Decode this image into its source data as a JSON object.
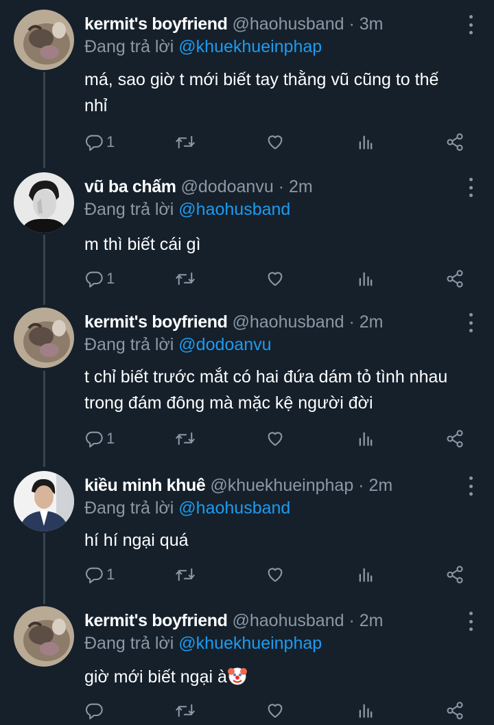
{
  "tweets": [
    {
      "name": "kermit's boyfriend",
      "handle": "@haohusband",
      "separator": "·",
      "time": "3m",
      "reply_prefix": "Đang trả lời",
      "reply_to": "@khuekhueinphap",
      "text_lines": [
        "má, sao giờ t mới biết tay thằng vũ cũng to thế",
        "nhỉ"
      ],
      "reply_count": "1",
      "avatar": "cat-avatar"
    },
    {
      "name": "vũ ba chấm",
      "handle": "@dodoanvu",
      "separator": "·",
      "time": "2m",
      "reply_prefix": "Đang trả lời",
      "reply_to": "@haohusband",
      "text_lines": [
        "m thì biết cái gì"
      ],
      "reply_count": "1",
      "avatar": "person-bw-avatar"
    },
    {
      "name": "kermit's boyfriend",
      "handle": "@haohusband",
      "separator": "·",
      "time": "2m",
      "reply_prefix": "Đang trả lời",
      "reply_to": "@dodoanvu",
      "text_lines": [
        "t chỉ biết trước mắt có hai đứa dám tỏ tình nhau",
        "trong đám đông mà mặc kệ người đời"
      ],
      "reply_count": "1",
      "avatar": "cat-avatar"
    },
    {
      "name": "kiều minh khuê",
      "handle": "@khuekhueinphap",
      "separator": "·",
      "time": "2m",
      "reply_prefix": "Đang trả lời",
      "reply_to": "@haohusband",
      "text_lines": [
        "hí hí ngại quá"
      ],
      "reply_count": "1",
      "avatar": "person-suit-avatar"
    },
    {
      "name": "kermit's boyfriend",
      "handle": "@haohusband",
      "separator": "·",
      "time": "2m",
      "reply_prefix": "Đang trả lời",
      "reply_to": "@khuekhueinphap",
      "text_lines": [
        "giờ mới biết ngại à"
      ],
      "trailing_emoji": "clown-face-emoji",
      "reply_count": "",
      "avatar": "cat-avatar"
    }
  ],
  "icons": {
    "reply": "reply-icon",
    "retweet": "retweet-icon",
    "like": "heart-icon",
    "analytics": "analytics-icon",
    "share": "share-icon",
    "more": "more-vertical-icon"
  },
  "colors": {
    "background": "#15202b",
    "text": "#ffffff",
    "secondary": "#8b98a5",
    "link": "#1d9bf0",
    "thread_line": "#38444d"
  }
}
